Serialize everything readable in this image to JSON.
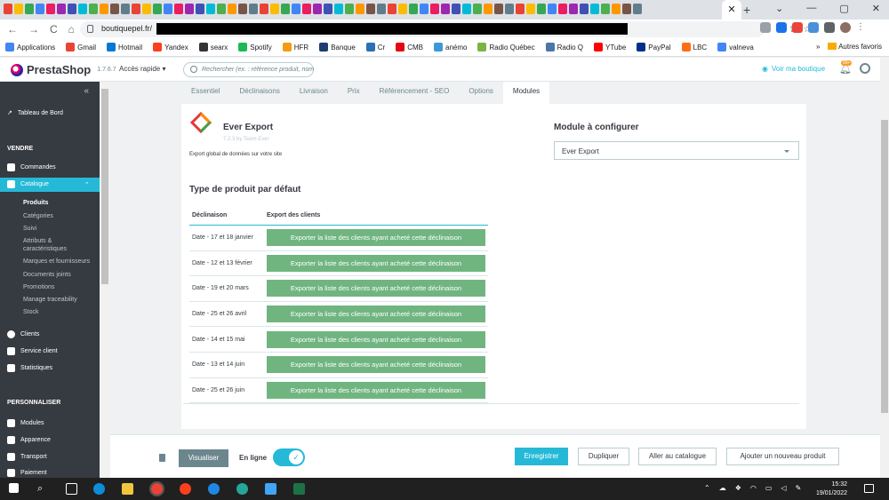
{
  "browser": {
    "tab_close": "✕",
    "new_tab": "+",
    "window_controls": [
      "⌄",
      "—",
      "▢",
      "✕"
    ],
    "url": "boutiquepel.fr/",
    "nav": {
      "back": "←",
      "forward": "→",
      "reload": "C",
      "home": "⌂"
    },
    "bookmarks": [
      {
        "label": "Applications",
        "color": "#4285f4"
      },
      {
        "label": "Gmail",
        "color": "#ea4335"
      },
      {
        "label": "Hotmail",
        "color": "#0078d4"
      },
      {
        "label": "Yandex",
        "color": "#fc3f1d"
      },
      {
        "label": "searx",
        "color": "#333333"
      },
      {
        "label": "Spotify",
        "color": "#1db954"
      },
      {
        "label": "HFR",
        "color": "#f39c12"
      },
      {
        "label": "Banque",
        "color": "#1a3e6e"
      },
      {
        "label": "Cr",
        "color": "#2c6fb5"
      },
      {
        "label": "CMB",
        "color": "#e30613"
      },
      {
        "label": "anémo",
        "color": "#3a9ad9"
      },
      {
        "label": "Radio Québec",
        "color": "#7cb342"
      },
      {
        "label": "Radio Q",
        "color": "#4a76a8"
      },
      {
        "label": "YTube",
        "color": "#ff0000"
      },
      {
        "label": "PayPal",
        "color": "#003087"
      },
      {
        "label": "LBC",
        "color": "#ff6e14"
      },
      {
        "label": "valneva",
        "color": "#4285f4"
      }
    ],
    "bookmarks_more": "»",
    "other_bookmarks": "Autres favoris"
  },
  "header": {
    "brand": "PrestaShop",
    "version": "1.7.6.7",
    "quick_access": "Accès rapide ▾",
    "search_placeholder": "Rechercher (ex. : référence produit, nom",
    "view_shop": "Voir ma boutique",
    "notif_count": "99+"
  },
  "sidebar": {
    "collapse": "«",
    "dashboard": "Tableau de Bord",
    "section_sell": "VENDRE",
    "orders": "Commandes",
    "catalog": "Catalogue",
    "catalog_sub": [
      "Produits",
      "Catégories",
      "Suivi",
      "Attributs &",
      "caractéristiques",
      "Marques et fournisseurs",
      "Documents joints",
      "Promotions",
      "Manage traceability",
      "Stock"
    ],
    "customers": "Clients",
    "service": "Service client",
    "stats": "Statistiques",
    "section_custom": "PERSONNALISER",
    "modules": "Modules",
    "appearance": "Apparence",
    "transport": "Transport",
    "payment": "Paiement"
  },
  "product_tabs": [
    "Essentiel",
    "Déclinaisons",
    "Livraison",
    "Prix",
    "Référencement - SEO",
    "Options",
    "Modules"
  ],
  "module": {
    "name": "Ever Export",
    "version_by": "7.2.3 by Team Ever",
    "description": "Export global de données sur votre site",
    "configure_title": "Module à configurer",
    "configure_value": "Ever Export"
  },
  "export_table": {
    "title": "Type de produit par défaut",
    "col1": "Déclinaison",
    "col2": "Export des clients",
    "button_label": "Exporter la liste des clients ayant acheté cette déclinaison",
    "rows": [
      "Date - 17 et 18 janvier",
      "Date - 12 et 13 février",
      "Date - 19 et 20 mars",
      "Date - 25 et 26 avril",
      "Date - 14 et 15 mai",
      "Date - 13 et 14 juin",
      "Date - 25 et 26 juin"
    ]
  },
  "footer": {
    "preview": "Visualiser",
    "online": "En ligne",
    "save": "Enregistrer",
    "duplicate": "Dupliquer",
    "to_catalog": "Aller au catalogue",
    "add_new": "Ajouter un nouveau produit"
  },
  "taskbar": {
    "time": "15:32",
    "date": "19/01/2022"
  }
}
